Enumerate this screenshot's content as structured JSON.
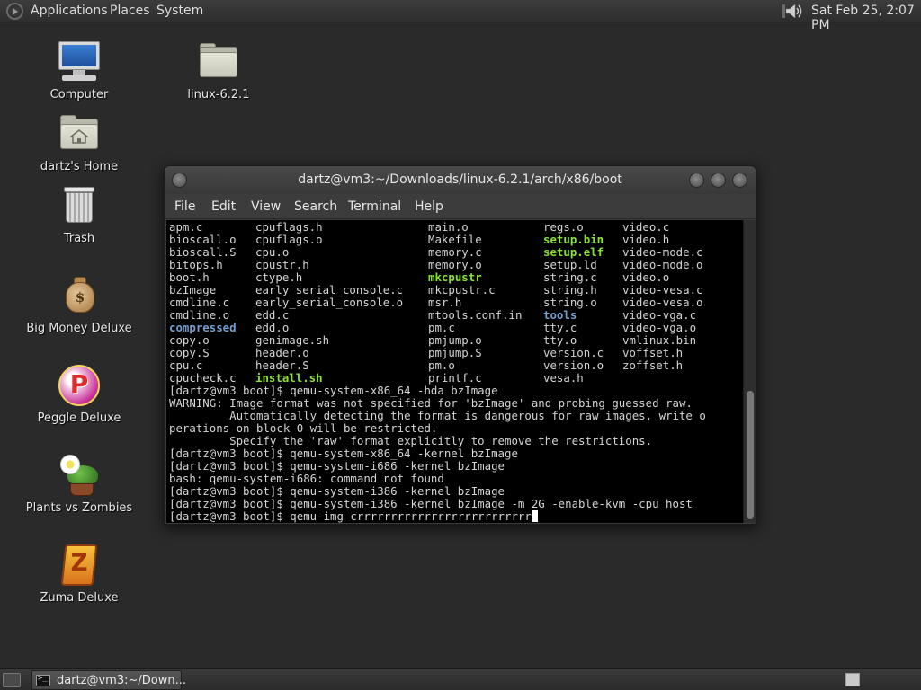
{
  "top_panel": {
    "menus": [
      "Applications",
      "Places",
      "System"
    ],
    "clock": "Sat Feb 25,  2:07 PM"
  },
  "desktop_icons": [
    {
      "label": "Computer"
    },
    {
      "label": "linux-6.2.1"
    },
    {
      "label": "dartz's Home"
    },
    {
      "label": "Trash"
    },
    {
      "label": "Big Money Deluxe"
    },
    {
      "label": "Peggle Deluxe"
    },
    {
      "label": "Plants vs Zombies"
    },
    {
      "label": "Zuma Deluxe"
    }
  ],
  "terminal": {
    "title": "dartz@vm3:~/Downloads/linux-6.2.1/arch/x86/boot",
    "menu": [
      "File",
      "Edit",
      "View",
      "Search",
      "Terminal",
      "Help"
    ],
    "ls_rows": [
      [
        {
          "t": "apm.c"
        },
        {
          "t": "cpuflags.h"
        },
        {
          "t": "main.o"
        },
        {
          "t": "regs.o"
        },
        {
          "t": "video.c"
        }
      ],
      [
        {
          "t": "bioscall.o"
        },
        {
          "t": "cpuflags.o"
        },
        {
          "t": "Makefile"
        },
        {
          "t": "setup.bin",
          "k": "exec"
        },
        {
          "t": "video.h"
        }
      ],
      [
        {
          "t": "bioscall.S"
        },
        {
          "t": "cpu.o"
        },
        {
          "t": "memory.c"
        },
        {
          "t": "setup.elf",
          "k": "exec"
        },
        {
          "t": "video-mode.c"
        }
      ],
      [
        {
          "t": "bitops.h"
        },
        {
          "t": "cpustr.h"
        },
        {
          "t": "memory.o"
        },
        {
          "t": "setup.ld"
        },
        {
          "t": "video-mode.o"
        }
      ],
      [
        {
          "t": "boot.h"
        },
        {
          "t": "ctype.h"
        },
        {
          "t": "mkcpustr",
          "k": "exec"
        },
        {
          "t": "string.c"
        },
        {
          "t": "video.o"
        }
      ],
      [
        {
          "t": "bzImage"
        },
        {
          "t": "early_serial_console.c"
        },
        {
          "t": "mkcpustr.c"
        },
        {
          "t": "string.h"
        },
        {
          "t": "video-vesa.c"
        }
      ],
      [
        {
          "t": "cmdline.c"
        },
        {
          "t": "early_serial_console.o"
        },
        {
          "t": "msr.h"
        },
        {
          "t": "string.o"
        },
        {
          "t": "video-vesa.o"
        }
      ],
      [
        {
          "t": "cmdline.o"
        },
        {
          "t": "edd.c"
        },
        {
          "t": "mtools.conf.in"
        },
        {
          "t": "tools",
          "k": "dir"
        },
        {
          "t": "video-vga.c"
        }
      ],
      [
        {
          "t": "compressed",
          "k": "dir"
        },
        {
          "t": "edd.o"
        },
        {
          "t": "pm.c"
        },
        {
          "t": "tty.c"
        },
        {
          "t": "video-vga.o"
        }
      ],
      [
        {
          "t": "copy.o"
        },
        {
          "t": "genimage.sh"
        },
        {
          "t": "pmjump.o"
        },
        {
          "t": "tty.o"
        },
        {
          "t": "vmlinux.bin"
        }
      ],
      [
        {
          "t": "copy.S"
        },
        {
          "t": "header.o"
        },
        {
          "t": "pmjump.S"
        },
        {
          "t": "version.c"
        },
        {
          "t": "voffset.h"
        }
      ],
      [
        {
          "t": "cpu.c"
        },
        {
          "t": "header.S"
        },
        {
          "t": "pm.o"
        },
        {
          "t": "version.o"
        },
        {
          "t": "zoffset.h"
        }
      ],
      [
        {
          "t": "cpucheck.c"
        },
        {
          "t": "install.sh",
          "k": "exec"
        },
        {
          "t": "printf.c"
        },
        {
          "t": "vesa.h"
        },
        {
          "t": ""
        }
      ]
    ],
    "output_lines": [
      "[dartz@vm3 boot]$ qemu-system-x86_64 -hda bzImage",
      "WARNING: Image format was not specified for 'bzImage' and probing guessed raw.",
      "         Automatically detecting the format is dangerous for raw images, write o",
      "perations on block 0 will be restricted.",
      "         Specify the 'raw' format explicitly to remove the restrictions.",
      "[dartz@vm3 boot]$ qemu-system-x86_64 -kernel bzImage",
      "[dartz@vm3 boot]$ qemu-system-i686 -kernel bzImage",
      "bash: qemu-system-i686: command not found",
      "[dartz@vm3 boot]$ qemu-system-i386 -kernel bzImage",
      "[dartz@vm3 boot]$ qemu-system-i386 -kernel bzImage -m 2G -enable-kvm -cpu host"
    ],
    "prompt_line": "[dartz@vm3 boot]$ qemu-img crrrrrrrrrrrrrrrrrrrrrrrrrr"
  },
  "bottom_panel": {
    "task_label": "dartz@vm3:~/Down..."
  },
  "colors": {
    "exec": "#8ae234",
    "dir": "#729fcf",
    "terminal_bg": "#000000",
    "terminal_fg": "#d4d4d4"
  },
  "icons": {
    "panel_menu": "gnome-foot-icon",
    "volume": "speaker-icon",
    "task": "terminal-icon",
    "workspace": "workspace-switcher-icon"
  }
}
